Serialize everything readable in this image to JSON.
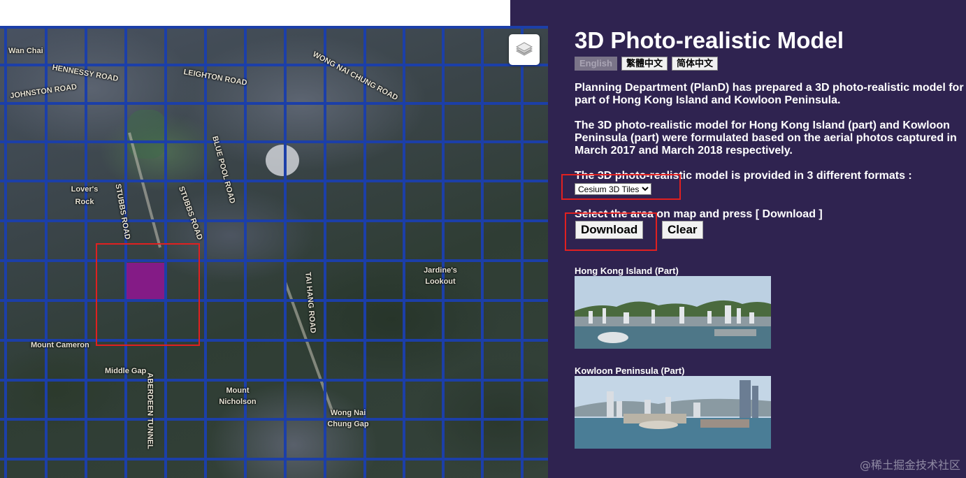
{
  "map": {
    "labels": [
      "Wan Chai",
      "HENNESSY ROAD",
      "JOHNSTON ROAD",
      "LEIGHTON ROAD",
      "WONG NAI CHUNG ROAD",
      "Lover's Rock",
      "STUBBS ROAD",
      "Jardine's Lookout",
      "Mount Cameron",
      "Middle Gap",
      "Mount Nicholson",
      "Wong Nai Chung Gap",
      "TAI HANG ROAD",
      "ABERDEEN TUNNEL",
      "STUBBS ROAD",
      "BLUE POOL ROAD"
    ],
    "layers_icon": "layers-icon"
  },
  "panel": {
    "title": "3D Photo-realistic Model",
    "languages": [
      "English",
      "繁體中文",
      "简体中文"
    ],
    "intro": "Planning Department (PlanD) has prepared a 3D photo-realistic model for part of Hong Kong Island and Kowloon Peninsula.",
    "formulated": "The 3D photo-realistic model for Hong Kong Island (part) and Kowloon Peninsula (part) were formulated based on the aerial photos captured in March 2017 and March 2018 respectively.",
    "formats_text": "The 3D photo-realistic model is provided in 3 different formats :",
    "format_selected": "Cesium 3D Tiles",
    "instruction": "Select the area on map and press [ Download ]",
    "download_label": "Download",
    "clear_label": "Clear",
    "hk_caption": "Hong Kong Island (Part)",
    "kowloon_caption": "Kowloon Peninsula (Part)"
  },
  "watermark": "@稀土掘金技术社区",
  "colors": {
    "panel_bg": "#2f2350",
    "grid": "#1c3fa8",
    "selection": "#961496",
    "highlight": "#e02020"
  }
}
